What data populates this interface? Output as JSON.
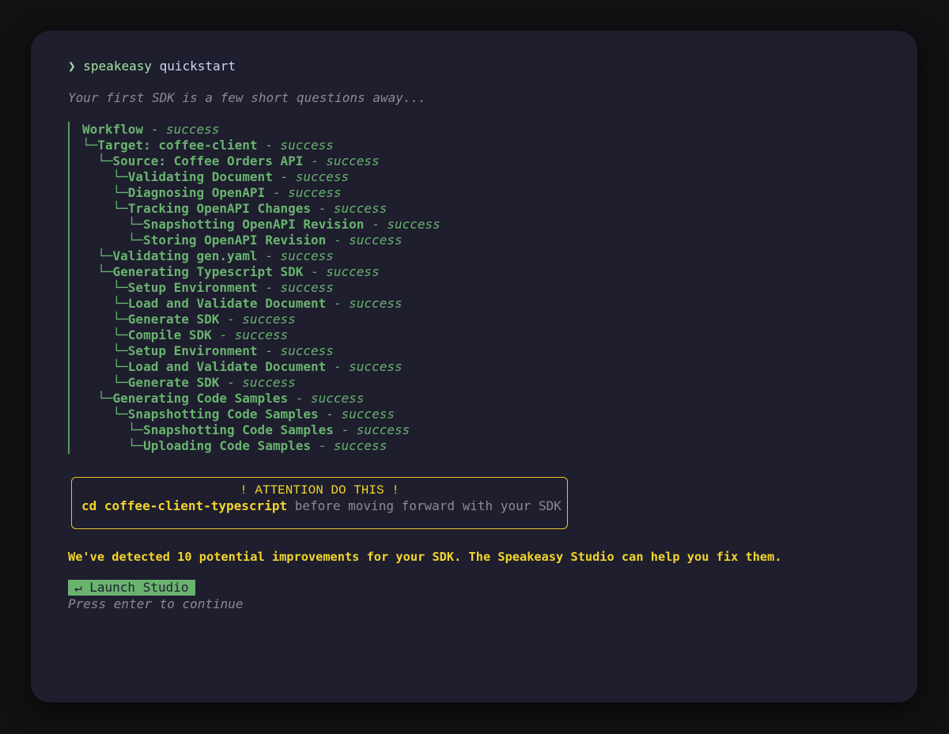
{
  "prompt": {
    "arrow": "❯",
    "command": "speakeasy",
    "argument": "quickstart"
  },
  "subtitle": "Your first SDK is a few short questions away...",
  "tree": [
    {
      "prefix": "",
      "label": "Workflow",
      "sep": " - ",
      "status": "success"
    },
    {
      "prefix": "└─",
      "label": "Target: coffee-client",
      "sep": " - ",
      "status": "success"
    },
    {
      "prefix": "  └─",
      "label": "Source: Coffee Orders API",
      "sep": " - ",
      "status": "success"
    },
    {
      "prefix": "    └─",
      "label": "Validating Document",
      "sep": " - ",
      "status": "success"
    },
    {
      "prefix": "    └─",
      "label": "Diagnosing OpenAPI",
      "sep": " - ",
      "status": "success"
    },
    {
      "prefix": "    └─",
      "label": "Tracking OpenAPI Changes",
      "sep": " - ",
      "status": "success"
    },
    {
      "prefix": "      └─",
      "label": "Snapshotting OpenAPI Revision",
      "sep": " - ",
      "status": "success"
    },
    {
      "prefix": "      └─",
      "label": "Storing OpenAPI Revision",
      "sep": " - ",
      "status": "success"
    },
    {
      "prefix": "  └─",
      "label": "Validating gen.yaml",
      "sep": " - ",
      "status": "success"
    },
    {
      "prefix": "  └─",
      "label": "Generating Typescript SDK",
      "sep": " - ",
      "status": "success"
    },
    {
      "prefix": "    └─",
      "label": "Setup Environment",
      "sep": " - ",
      "status": "success"
    },
    {
      "prefix": "    └─",
      "label": "Load and Validate Document",
      "sep": " - ",
      "status": "success"
    },
    {
      "prefix": "    └─",
      "label": "Generate SDK",
      "sep": " - ",
      "status": "success"
    },
    {
      "prefix": "    └─",
      "label": "Compile SDK",
      "sep": " - ",
      "status": "success"
    },
    {
      "prefix": "    └─",
      "label": "Setup Environment",
      "sep": " - ",
      "status": "success"
    },
    {
      "prefix": "    └─",
      "label": "Load and Validate Document",
      "sep": " - ",
      "status": "success"
    },
    {
      "prefix": "    └─",
      "label": "Generate SDK",
      "sep": " - ",
      "status": "success"
    },
    {
      "prefix": "  └─",
      "label": "Generating Code Samples",
      "sep": " - ",
      "status": "success"
    },
    {
      "prefix": "    └─",
      "label": "Snapshotting Code Samples",
      "sep": " - ",
      "status": "success"
    },
    {
      "prefix": "      └─",
      "label": "Snapshotting Code Samples",
      "sep": " - ",
      "status": "success"
    },
    {
      "prefix": "      └─",
      "label": "Uploading Code Samples",
      "sep": " - ",
      "status": "success"
    }
  ],
  "attention": {
    "title": "! ATTENTION DO THIS !",
    "command": "cd coffee-client-typescript",
    "rest": " before moving forward with your SDK"
  },
  "improvements": "We've detected 10 potential improvements for your SDK. The Speakeasy Studio can help you fix them.",
  "launch_button": "↵ Launch Studio",
  "hint": "Press enter to continue",
  "colors": {
    "background": "#1e1e2e",
    "success_green": "#69b36f",
    "attention_yellow": "#f2d52b",
    "muted": "#8a8a99"
  }
}
